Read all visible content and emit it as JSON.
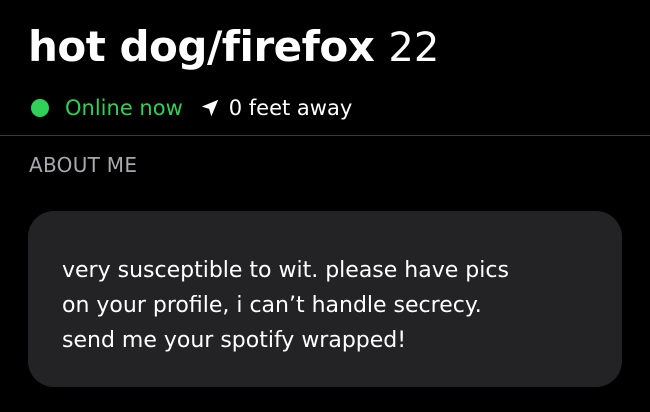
{
  "profile": {
    "display_name": "hot dog/firefox",
    "age": "22"
  },
  "status": {
    "online_label": "Online now",
    "online_color": "#2fd158",
    "distance_label": "0 feet away",
    "location_icon": "location-arrow-icon"
  },
  "about": {
    "section_label": "ABOUT ME",
    "bio": "very susceptible to wit. please have pics\non your profile, i can’t handle secrecy.\nsend me your spotify wrapped!"
  }
}
